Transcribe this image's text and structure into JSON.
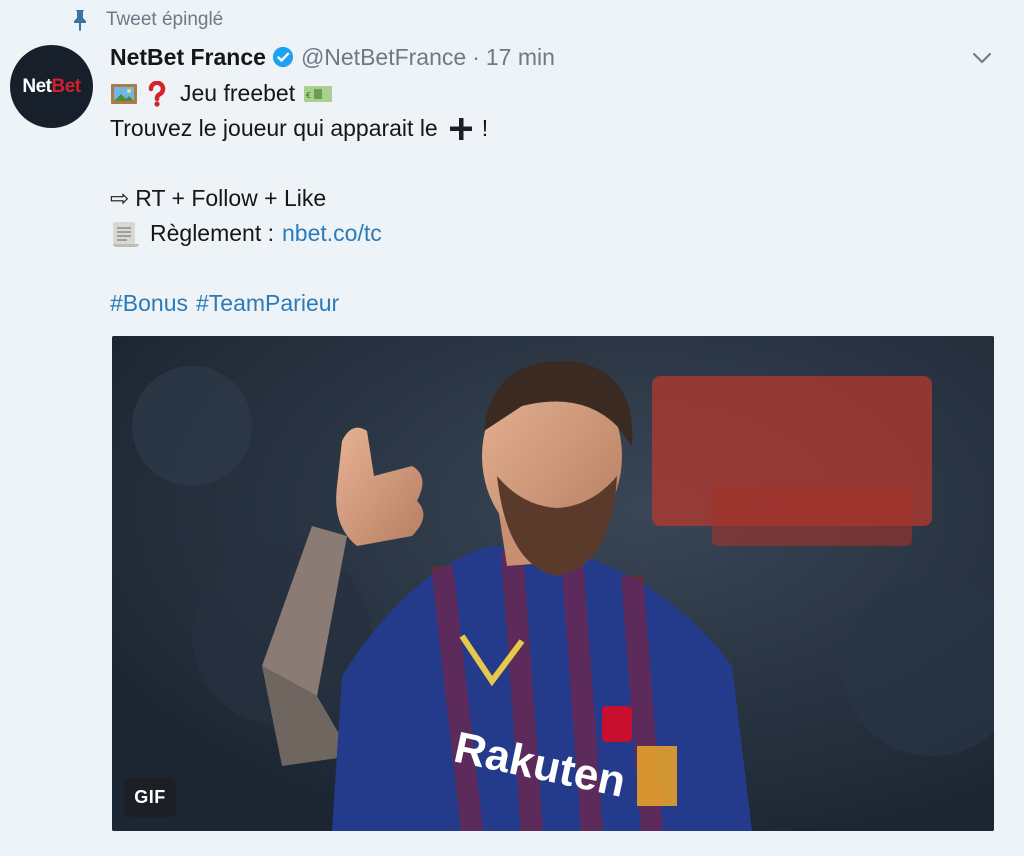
{
  "pinned": {
    "label": "Tweet épinglé"
  },
  "author": {
    "avatar_text_white": "Net",
    "avatar_text_red": "Bet",
    "name": "NetBet France",
    "handle": "@NetBetFrance",
    "separator": "·",
    "time": "17 min"
  },
  "tweet": {
    "line1_text": "Jeu freebet",
    "line2_text": "Trouvez le joueur qui apparait le",
    "line2_end": "!",
    "line3_prefix": "⇨",
    "line3_text": "RT + Follow + Like",
    "line4_text": "Règlement :",
    "line4_link": "nbet.co/tc",
    "hashtag1": "#Bonus",
    "hashtag2": "#TeamParieur"
  },
  "media": {
    "badge": "GIF",
    "sponsor_text": "Rakuten"
  },
  "colors": {
    "background": "#eef3f8",
    "link": "#2b7bb9",
    "muted": "#6d7a86",
    "verified": "#1da1f2",
    "brand_red": "#d21f2f"
  }
}
